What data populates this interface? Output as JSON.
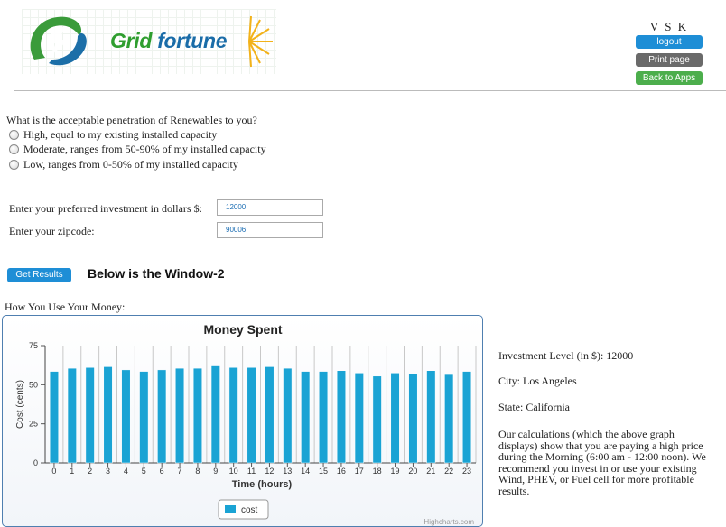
{
  "header": {
    "brand_part1": "Grid",
    "brand_part2": "fortune",
    "user": "V S K",
    "logout_label": "logout",
    "print_label": "Print page",
    "back_label": "Back to Apps"
  },
  "question": {
    "prompt": "What is the acceptable penetration of Renewables to you?",
    "options": [
      "High, equal to my existing installed capacity",
      "Moderate, ranges from 50-90% of my installed capacity",
      "Low, ranges from 0-50% of my installed capacity"
    ]
  },
  "form": {
    "investment_label": "Enter your preferred investment in dollars $:",
    "investment_value": "12000",
    "zipcode_label": "Enter your zipcode:",
    "zipcode_value": "90006",
    "get_results_label": "Get Results",
    "window_note": "Below is the Window-2"
  },
  "usage_label": "How You Use Your Money:",
  "chart_data": {
    "type": "bar",
    "title": "Money Spent",
    "xlabel": "Time (hours)",
    "ylabel": "Cost (cents)",
    "ylim": [
      0,
      75
    ],
    "yticks": [
      0,
      25,
      50,
      75
    ],
    "categories": [
      "0",
      "1",
      "2",
      "3",
      "4",
      "5",
      "6",
      "7",
      "8",
      "9",
      "10",
      "11",
      "12",
      "13",
      "14",
      "15",
      "16",
      "17",
      "18",
      "19",
      "20",
      "21",
      "22",
      "23"
    ],
    "series": [
      {
        "name": "cost",
        "color": "#1aa3d4",
        "values": [
          58.5,
          60.5,
          61,
          61.5,
          59.5,
          58.5,
          59.5,
          60.5,
          60.5,
          62,
          61,
          61,
          61.5,
          60.5,
          58.5,
          58.5,
          59,
          57.5,
          55.5,
          57.5,
          57,
          59,
          56.5,
          58.5
        ]
      }
    ],
    "grid": true,
    "legend": "bottom-center",
    "credit": "Highcharts.com"
  },
  "info": {
    "investment_level": "Investment Level (in $): 12000",
    "city": "City: Los Angeles",
    "state": "State: California",
    "message": "Our calculations (which the above graph displays) show that you are paying a high price during the Morning (6:00 am - 12:00 noon). We recommend you invest in or use your existing Wind, PHEV, or Fuel cell for more profitable results."
  },
  "colors": {
    "accent_blue": "#1e8ed6",
    "print_gray": "#6a6a6a",
    "back_green": "#4cae4c",
    "bar_blue": "#1aa3d4"
  }
}
